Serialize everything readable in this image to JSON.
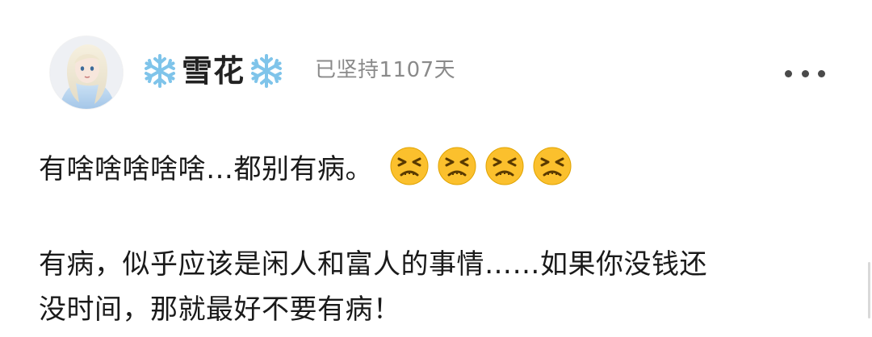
{
  "post": {
    "author_name": "雪花",
    "streak_text": "已坚持1107天",
    "line1_text": "有啥啥啥啥啥…都别有病。",
    "line1_emoji_count": 4,
    "emoji_icon": "persevering-face-icon",
    "paragraph2_line1": "有病，似乎应该是闲人和富人的事情……如果你没钱还",
    "paragraph2_line2": "没时间，那就最好不要有病！"
  },
  "icons": {
    "name_prefix": "snowflake-icon",
    "name_suffix": "snowflake-icon",
    "more": "more-horizontal-icon"
  },
  "colors": {
    "text_primary": "#1a1a1a",
    "text_secondary": "#8a8a8a",
    "snowflake": "#7fc4ea",
    "emoji_face": "#fbc02d"
  }
}
